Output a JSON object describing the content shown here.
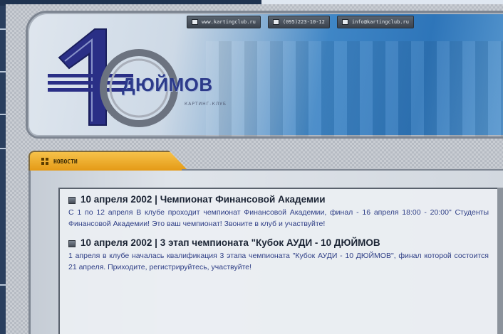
{
  "header": {
    "links": [
      {
        "icon": "phone-icon",
        "label": "www.kartingclub.ru"
      },
      {
        "icon": "fax-icon",
        "label": "(095)223-10-12"
      },
      {
        "icon": "mail-icon",
        "label": "info@kartingclub.ru"
      }
    ]
  },
  "logo": {
    "numeral": "10",
    "name": "ДЮЙМОВ",
    "subtitle": "КАРТИНГ-КЛУБ"
  },
  "tab": {
    "label": "НОВОСТИ"
  },
  "news": [
    {
      "title": "10 апреля 2002 | Чемпионат Финансовой Академии",
      "body": "С 1 по 12 апреля В клубе проходит чемпионат Финансовой Академии, финал - 16 апреля 18:00 - 20:00\" Студенты Финансовой Академии! Это ваш чемпионат! Звоните в клуб и участвуйте!"
    },
    {
      "title": "10 апреля 2002 | 3 этап чемпионата \"Кубок АУДИ - 10 ДЮЙМОВ",
      "body": "1 апреля в клубе началась квалификация 3 этапа чемпионата \"Кубок АУДИ - 10 ДЮЙМОВ\", финал которой состоится 21 апреля. Приходите, регистрируйтесь, участвуйте!"
    }
  ],
  "colors": {
    "tab_orange": "#e49a16",
    "body_text": "#2f3f86",
    "logo_blue": "#2c3a8a"
  }
}
